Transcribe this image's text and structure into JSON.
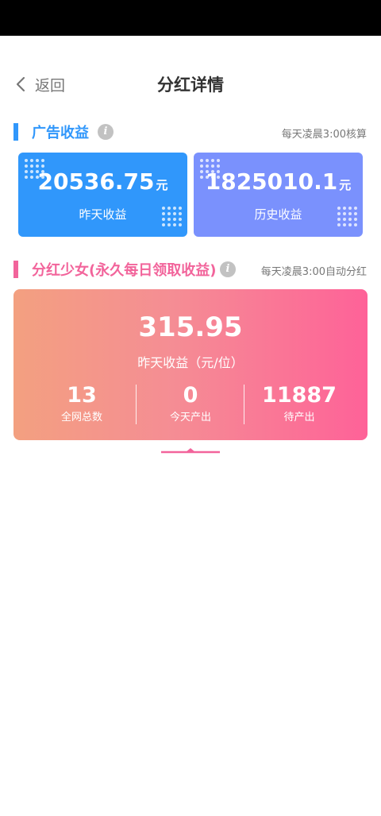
{
  "header": {
    "back_label": "返回",
    "title": "分红详情"
  },
  "ad_income": {
    "title": "广告收益",
    "note": "每天凌晨3:00核算",
    "accent": "#3097fb",
    "cards": [
      {
        "amount": "20536.75",
        "unit": "元",
        "label": "昨天收益",
        "color": "#3097fb"
      },
      {
        "amount": "1825010.1",
        "unit": "元",
        "label": "历史收益",
        "color": "#7a91fd"
      }
    ]
  },
  "dividend": {
    "title": "分红少女(永久每日领取收益)",
    "note": "每天凌晨3:00自动分红",
    "accent": "#f2649b",
    "amount": "315.95",
    "amount_label": "昨天收益（元/位）",
    "stats": [
      {
        "value": "13",
        "label": "全网总数"
      },
      {
        "value": "0",
        "label": "今天产出"
      },
      {
        "value": "11887",
        "label": "待产出"
      }
    ],
    "gradient": [
      "#f3a080",
      "#fe6298"
    ]
  },
  "icons": [
    "chevron-left-icon",
    "info-icon",
    "dot-grid-icon"
  ]
}
